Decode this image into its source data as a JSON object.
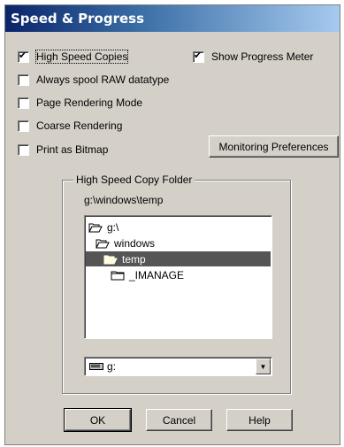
{
  "window": {
    "title": "Speed & Progress"
  },
  "options": {
    "high_speed_copies": {
      "label": "High Speed Copies",
      "checked": true
    },
    "show_progress_meter": {
      "label": "Show Progress Meter",
      "checked": true
    },
    "always_spool_raw": {
      "label": "Always spool RAW datatype",
      "checked": false
    },
    "page_rendering_mode": {
      "label": "Page Rendering Mode",
      "checked": false
    },
    "coarse_rendering": {
      "label": "Coarse Rendering",
      "checked": false
    },
    "print_as_bitmap": {
      "label": "Print as Bitmap",
      "checked": false
    }
  },
  "monitoring_button": {
    "label": "Monitoring Preferences"
  },
  "folder_group": {
    "title": "High Speed Copy Folder",
    "current_path": "g:\\windows\\temp",
    "tree": [
      {
        "label": "g:\\",
        "icon": "open-folder-icon",
        "selected": false
      },
      {
        "label": "windows",
        "icon": "open-folder-icon",
        "selected": false
      },
      {
        "label": "temp",
        "icon": "open-folder-icon",
        "selected": true
      },
      {
        "label": "_IMANAGE",
        "icon": "closed-folder-icon",
        "selected": false
      }
    ],
    "drive": {
      "value": "g:",
      "icon": "drive-icon"
    }
  },
  "buttons": {
    "ok": "OK",
    "cancel": "Cancel",
    "help": "Help"
  }
}
